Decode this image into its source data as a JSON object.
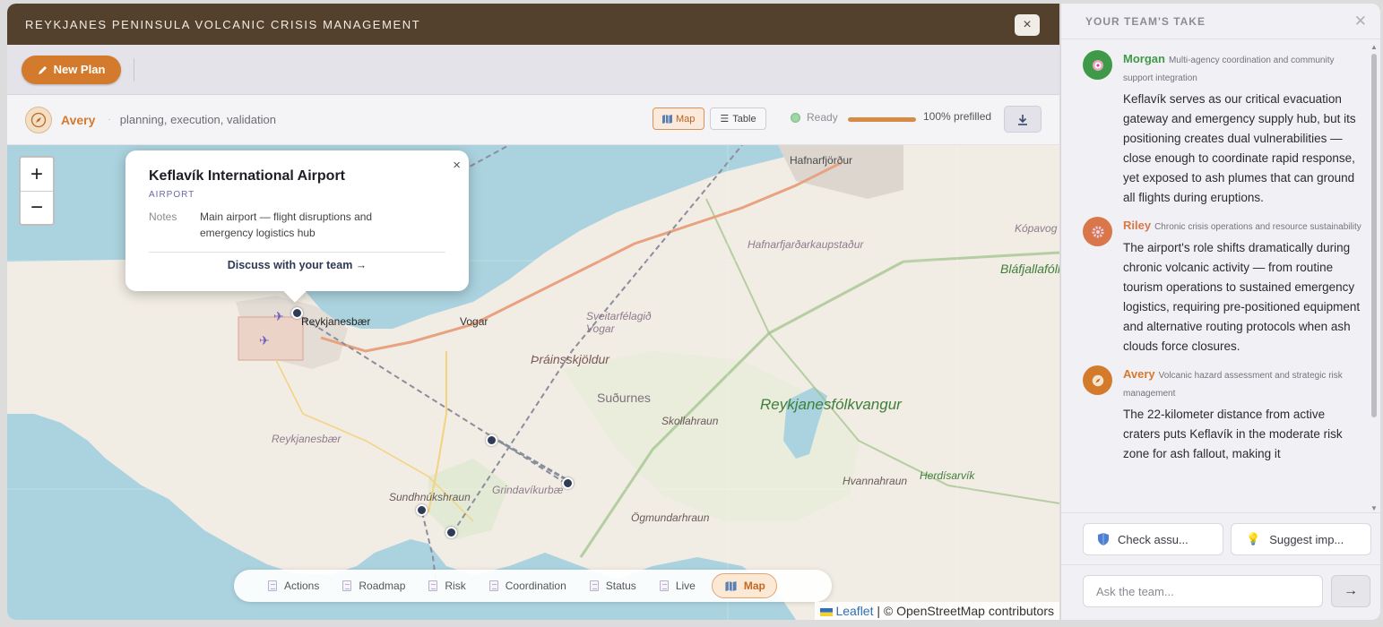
{
  "window": {
    "title": "Reykjanes Peninsula Volcanic Crisis Management",
    "close_icon": "×"
  },
  "toolbar": {
    "new_plan_label": "New Plan"
  },
  "agent": {
    "name": "Avery",
    "description": "planning, execution, validation",
    "view_map_label": "Map",
    "view_table_label": "Table",
    "status": "Ready",
    "progress_fraction": 1.0,
    "prefilled_label": "100% prefilled"
  },
  "map": {
    "zoom_in": "+",
    "zoom_out": "−",
    "labels": {
      "hafnarfjordur": "Hafnarfjörður",
      "kopavogur": "Kópavog",
      "hafnarfjardarkaupstadur": "Hafnarfjarðarkaupstaður",
      "blafjallafolk": "Bláfjallafólk",
      "reykjanesbaer_town": "Reykjanesbær",
      "vogar": "Vogar",
      "sveitarfelagid_vogar": "Sveitarfélagið Vogar",
      "thrainsskjoldur": "Þráinsskjöldur",
      "sudurnes": "Suðurnes",
      "reykjanesfolkvangur": "Reykjanesfólkvangur",
      "skollahraun": "Skollahraun",
      "reykjanesbaer_region": "Reykjanesbær",
      "hvannahraun": "Hvannahraun",
      "herdisarvik": "Herdísarvík",
      "sundhnukshraun": "Sundhnúkshraun",
      "grindavikurbaer": "Grindavíkurbæ",
      "ogmundarhraun": "Ögmundarhraun"
    },
    "popup": {
      "title": "Keflavík International Airport",
      "type": "AIRPORT",
      "notes_key": "Notes",
      "notes_value": "Main airport — flight disruptions and emergency logistics hub",
      "link": "Discuss with your team →",
      "close": "×"
    },
    "attribution_leaflet": "Leaflet",
    "attribution_rest": " | © OpenStreetMap contributors"
  },
  "bottom_nav": [
    {
      "label": "Actions",
      "active": false
    },
    {
      "label": "Roadmap",
      "active": false
    },
    {
      "label": "Risk",
      "active": false
    },
    {
      "label": "Coordination",
      "active": false
    },
    {
      "label": "Status",
      "active": false
    },
    {
      "label": "Live",
      "active": false
    },
    {
      "label": "Map",
      "active": true
    }
  ],
  "team_panel": {
    "title": "YOUR TEAM'S TAKE",
    "messages": [
      {
        "name": "Morgan",
        "role": "Multi-agency coordination and community support integration",
        "text": "Keflavík serves as our critical evacuation gateway and emergency supply hub, but its positioning creates dual vulnerabilities — close enough to coordinate rapid response, yet exposed to ash plumes that can ground all flights during eruptions.",
        "color": "#3f9a48",
        "avatar_icon": "target-icon"
      },
      {
        "name": "Riley",
        "role": "Chronic crisis operations and resource sustainability",
        "text": "The airport's role shifts dramatically during chronic volcanic activity — from routine tourism operations to sustained emergency logistics, requiring pre-positioned equipment and alternative routing protocols when ash clouds force closures.",
        "color": "#d9774a",
        "avatar_icon": "gear-icon"
      },
      {
        "name": "Avery",
        "role": "Volcanic hazard assessment and strategic risk management",
        "text": "The 22-kilometer distance from active craters puts Keflavík in the moderate risk zone for ash fallout, making it",
        "color": "#d47a2d",
        "avatar_icon": "compass-icon"
      }
    ],
    "suggestion_1": "Check assu...",
    "suggestion_2": "Suggest imp...",
    "ask_placeholder": "Ask the team...",
    "send_icon": "→"
  }
}
